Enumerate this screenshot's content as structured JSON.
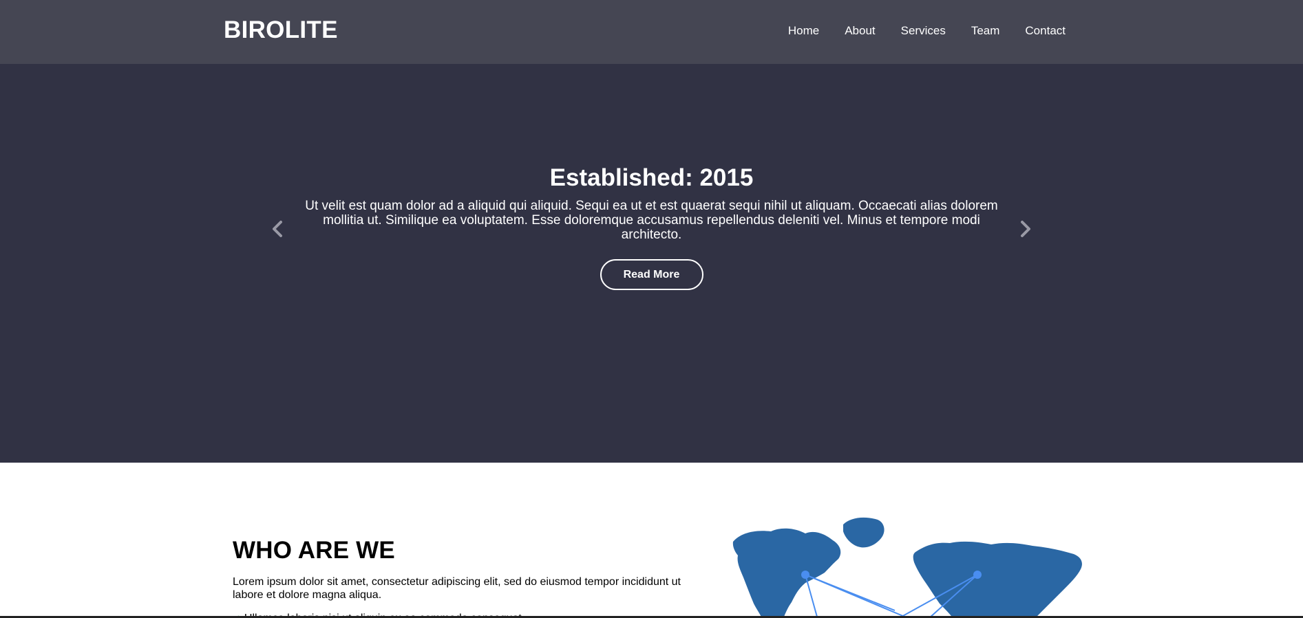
{
  "header": {
    "logo": "BIROLITE",
    "nav": [
      "Home",
      "About",
      "Services",
      "Team",
      "Contact"
    ]
  },
  "hero": {
    "title": "Established: 2015",
    "text": "Ut velit est quam dolor ad a aliquid qui aliquid. Sequi ea ut et est quaerat sequi nihil ut aliquam. Occaecati alias dolorem mollitia ut. Similique ea voluptatem. Esse doloremque accusamus repellendus deleniti vel. Minus et tempore modi architecto.",
    "button": "Read More",
    "prev_icon": "chevron-left-icon",
    "next_icon": "chevron-right-icon"
  },
  "about": {
    "title": "WHO ARE WE",
    "text": "Lorem ipsum dolor sit amet, consectetur adipiscing elit, sed do eiusmod tempor incididunt ut labore et dolore magna aliqua.",
    "bullet": "Ullamco laboris nisi ut aliquip ex ea commodo consequat.",
    "map_icon": "world-map-icon"
  },
  "colors": {
    "header_bg": "#454653",
    "hero_bg": "#313244",
    "map_blue": "#2a67a4",
    "node_blue": "#4a8ef0",
    "check_green": "#2ea44f"
  }
}
